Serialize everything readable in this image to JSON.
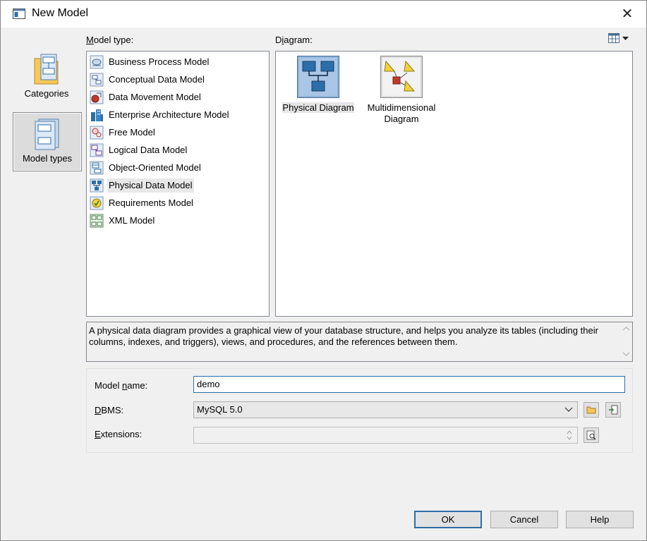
{
  "window": {
    "title": "New Model"
  },
  "sidebar": {
    "items": [
      {
        "label": "Categories",
        "icon": "categories-icon",
        "active": false
      },
      {
        "label": "Model types",
        "icon": "model-types-icon",
        "active": true
      }
    ]
  },
  "model_type": {
    "label": "Model type:",
    "items": [
      {
        "label": "Business Process Model",
        "icon": "business-process-icon"
      },
      {
        "label": "Conceptual Data Model",
        "icon": "conceptual-data-icon"
      },
      {
        "label": "Data Movement Model",
        "icon": "data-movement-icon"
      },
      {
        "label": "Enterprise Architecture Model",
        "icon": "enterprise-architecture-icon"
      },
      {
        "label": "Free Model",
        "icon": "free-model-icon"
      },
      {
        "label": "Logical Data Model",
        "icon": "logical-data-icon"
      },
      {
        "label": "Object-Oriented Model",
        "icon": "object-oriented-icon"
      },
      {
        "label": "Physical Data Model",
        "icon": "physical-data-icon",
        "selected": true
      },
      {
        "label": "Requirements Model",
        "icon": "requirements-icon"
      },
      {
        "label": "XML Model",
        "icon": "xml-model-icon"
      }
    ]
  },
  "diagram": {
    "label": "Diagram:",
    "items": [
      {
        "label_line1": "Physical Diagram",
        "label_line2": "",
        "icon": "physical-diagram-icon",
        "selected": true
      },
      {
        "label_line1": "Multidimensional",
        "label_line2": "Diagram",
        "icon": "multidimensional-diagram-icon"
      }
    ]
  },
  "description": "A physical data diagram provides a graphical view of your database structure, and helps you analyze its tables (including their columns, indexes, and triggers), views, and procedures, and the references between them.",
  "form": {
    "model_name_label": "Model name:",
    "model_name_value": "demo",
    "dbms_label": "DBMS:",
    "dbms_value": "MySQL 5.0",
    "extensions_label": "Extensions:",
    "extensions_value": ""
  },
  "buttons": {
    "ok": "OK",
    "cancel": "Cancel",
    "help": "Help"
  },
  "colors": {
    "accent": "#2b6ea8",
    "selection": "#e8e8e8"
  }
}
